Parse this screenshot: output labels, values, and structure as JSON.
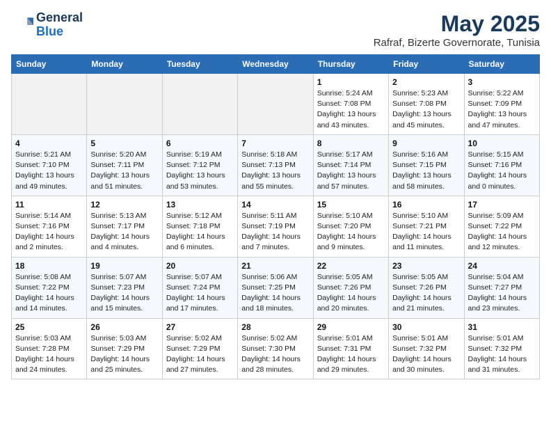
{
  "header": {
    "logo_line1": "General",
    "logo_line2": "Blue",
    "title": "May 2025",
    "subtitle": "Rafraf, Bizerte Governorate, Tunisia"
  },
  "days_of_week": [
    "Sunday",
    "Monday",
    "Tuesday",
    "Wednesday",
    "Thursday",
    "Friday",
    "Saturday"
  ],
  "weeks": [
    [
      {
        "num": "",
        "info": "",
        "empty": true
      },
      {
        "num": "",
        "info": "",
        "empty": true
      },
      {
        "num": "",
        "info": "",
        "empty": true
      },
      {
        "num": "",
        "info": "",
        "empty": true
      },
      {
        "num": "1",
        "info": "Sunrise: 5:24 AM\nSunset: 7:08 PM\nDaylight: 13 hours\nand 43 minutes."
      },
      {
        "num": "2",
        "info": "Sunrise: 5:23 AM\nSunset: 7:08 PM\nDaylight: 13 hours\nand 45 minutes."
      },
      {
        "num": "3",
        "info": "Sunrise: 5:22 AM\nSunset: 7:09 PM\nDaylight: 13 hours\nand 47 minutes."
      }
    ],
    [
      {
        "num": "4",
        "info": "Sunrise: 5:21 AM\nSunset: 7:10 PM\nDaylight: 13 hours\nand 49 minutes."
      },
      {
        "num": "5",
        "info": "Sunrise: 5:20 AM\nSunset: 7:11 PM\nDaylight: 13 hours\nand 51 minutes."
      },
      {
        "num": "6",
        "info": "Sunrise: 5:19 AM\nSunset: 7:12 PM\nDaylight: 13 hours\nand 53 minutes."
      },
      {
        "num": "7",
        "info": "Sunrise: 5:18 AM\nSunset: 7:13 PM\nDaylight: 13 hours\nand 55 minutes."
      },
      {
        "num": "8",
        "info": "Sunrise: 5:17 AM\nSunset: 7:14 PM\nDaylight: 13 hours\nand 57 minutes."
      },
      {
        "num": "9",
        "info": "Sunrise: 5:16 AM\nSunset: 7:15 PM\nDaylight: 13 hours\nand 58 minutes."
      },
      {
        "num": "10",
        "info": "Sunrise: 5:15 AM\nSunset: 7:16 PM\nDaylight: 14 hours\nand 0 minutes."
      }
    ],
    [
      {
        "num": "11",
        "info": "Sunrise: 5:14 AM\nSunset: 7:16 PM\nDaylight: 14 hours\nand 2 minutes."
      },
      {
        "num": "12",
        "info": "Sunrise: 5:13 AM\nSunset: 7:17 PM\nDaylight: 14 hours\nand 4 minutes."
      },
      {
        "num": "13",
        "info": "Sunrise: 5:12 AM\nSunset: 7:18 PM\nDaylight: 14 hours\nand 6 minutes."
      },
      {
        "num": "14",
        "info": "Sunrise: 5:11 AM\nSunset: 7:19 PM\nDaylight: 14 hours\nand 7 minutes."
      },
      {
        "num": "15",
        "info": "Sunrise: 5:10 AM\nSunset: 7:20 PM\nDaylight: 14 hours\nand 9 minutes."
      },
      {
        "num": "16",
        "info": "Sunrise: 5:10 AM\nSunset: 7:21 PM\nDaylight: 14 hours\nand 11 minutes."
      },
      {
        "num": "17",
        "info": "Sunrise: 5:09 AM\nSunset: 7:22 PM\nDaylight: 14 hours\nand 12 minutes."
      }
    ],
    [
      {
        "num": "18",
        "info": "Sunrise: 5:08 AM\nSunset: 7:22 PM\nDaylight: 14 hours\nand 14 minutes."
      },
      {
        "num": "19",
        "info": "Sunrise: 5:07 AM\nSunset: 7:23 PM\nDaylight: 14 hours\nand 15 minutes."
      },
      {
        "num": "20",
        "info": "Sunrise: 5:07 AM\nSunset: 7:24 PM\nDaylight: 14 hours\nand 17 minutes."
      },
      {
        "num": "21",
        "info": "Sunrise: 5:06 AM\nSunset: 7:25 PM\nDaylight: 14 hours\nand 18 minutes."
      },
      {
        "num": "22",
        "info": "Sunrise: 5:05 AM\nSunset: 7:26 PM\nDaylight: 14 hours\nand 20 minutes."
      },
      {
        "num": "23",
        "info": "Sunrise: 5:05 AM\nSunset: 7:26 PM\nDaylight: 14 hours\nand 21 minutes."
      },
      {
        "num": "24",
        "info": "Sunrise: 5:04 AM\nSunset: 7:27 PM\nDaylight: 14 hours\nand 23 minutes."
      }
    ],
    [
      {
        "num": "25",
        "info": "Sunrise: 5:03 AM\nSunset: 7:28 PM\nDaylight: 14 hours\nand 24 minutes."
      },
      {
        "num": "26",
        "info": "Sunrise: 5:03 AM\nSunset: 7:29 PM\nDaylight: 14 hours\nand 25 minutes."
      },
      {
        "num": "27",
        "info": "Sunrise: 5:02 AM\nSunset: 7:29 PM\nDaylight: 14 hours\nand 27 minutes."
      },
      {
        "num": "28",
        "info": "Sunrise: 5:02 AM\nSunset: 7:30 PM\nDaylight: 14 hours\nand 28 minutes."
      },
      {
        "num": "29",
        "info": "Sunrise: 5:01 AM\nSunset: 7:31 PM\nDaylight: 14 hours\nand 29 minutes."
      },
      {
        "num": "30",
        "info": "Sunrise: 5:01 AM\nSunset: 7:32 PM\nDaylight: 14 hours\nand 30 minutes."
      },
      {
        "num": "31",
        "info": "Sunrise: 5:01 AM\nSunset: 7:32 PM\nDaylight: 14 hours\nand 31 minutes."
      }
    ]
  ]
}
